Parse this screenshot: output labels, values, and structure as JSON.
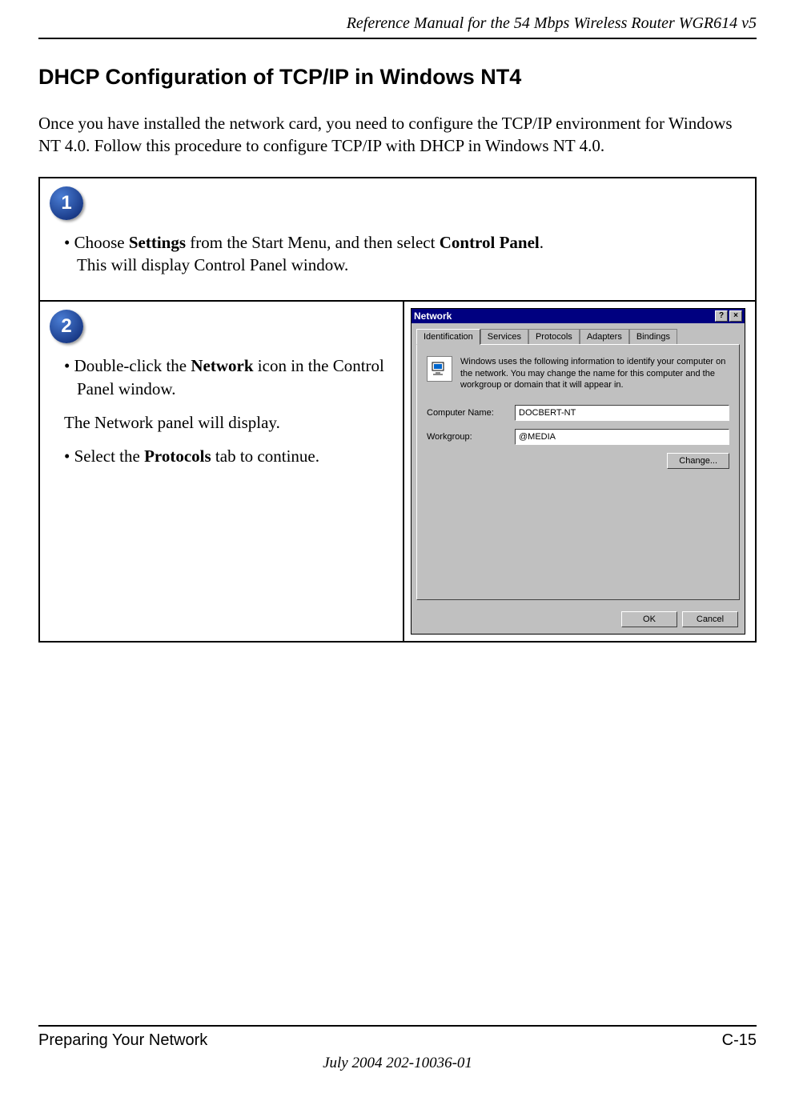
{
  "header": {
    "title": "Reference Manual for the 54 Mbps Wireless Router WGR614 v5"
  },
  "section": {
    "title": "DHCP Configuration of TCP/IP in Windows NT4",
    "intro": "Once you have installed the network card, you need to configure the TCP/IP environment for Windows NT 4.0. Follow this procedure to configure TCP/IP with DHCP in Windows NT 4.0."
  },
  "steps": {
    "one": {
      "num": "1",
      "line1_pre": "• Choose ",
      "line1_b1": "Settings",
      "line1_mid": " from the Start Menu, and then select ",
      "line1_b2": "Control Panel",
      "line1_post": ".",
      "line2": "This will display Control Panel window."
    },
    "two": {
      "num": "2",
      "p1_pre": "• Double-click the ",
      "p1_b": "Network",
      "p1_post": " icon in the Control Panel window.",
      "p2": "The Network panel will display.",
      "p3_pre": "• Select the ",
      "p3_b": "Protocols",
      "p3_post": " tab to continue."
    }
  },
  "dialog": {
    "title": "Network",
    "help_btn": "?",
    "close_btn": "×",
    "tabs": [
      "Identification",
      "Services",
      "Protocols",
      "Adapters",
      "Bindings"
    ],
    "info": "Windows uses the following information to identify your computer on the network.  You may change the name for this computer and the workgroup or domain that it will appear in.",
    "computer_label": "Computer Name:",
    "computer_value": "DOCBERT-NT",
    "workgroup_label": "Workgroup:",
    "workgroup_value": "@MEDIA",
    "change_btn": "Change...",
    "ok_btn": "OK",
    "cancel_btn": "Cancel"
  },
  "footer": {
    "left": "Preparing Your Network",
    "right": "C-15",
    "date": "July 2004 202-10036-01"
  }
}
